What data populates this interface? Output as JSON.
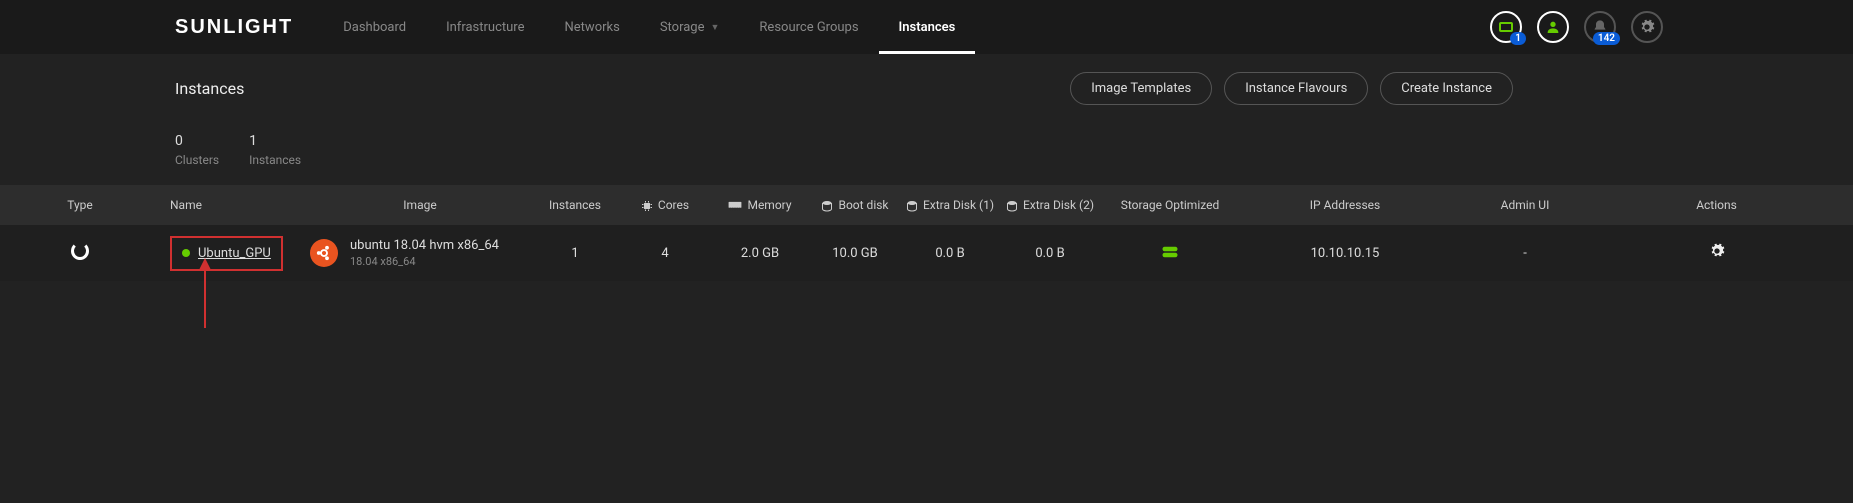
{
  "brand": "SUNLIGHT",
  "nav": {
    "items": [
      "Dashboard",
      "Infrastructure",
      "Networks",
      "Storage",
      "Resource Groups",
      "Instances"
    ],
    "active": "Instances"
  },
  "topicons": {
    "screen_badge": "1",
    "bell_badge": "142"
  },
  "page": {
    "title": "Instances",
    "actions": [
      "Image Templates",
      "Instance Flavours",
      "Create Instance"
    ]
  },
  "stats": [
    {
      "value": "0",
      "label": "Clusters"
    },
    {
      "value": "1",
      "label": "Instances"
    }
  ],
  "columns": {
    "type": "Type",
    "name": "Name",
    "image": "Image",
    "instances": "Instances",
    "cores": "Cores",
    "memory": "Memory",
    "boot": "Boot disk",
    "extra1": "Extra Disk (1)",
    "extra2": "Extra Disk (2)",
    "sopt": "Storage Optimized",
    "ip": "IP Addresses",
    "admin": "Admin UI",
    "actions": "Actions"
  },
  "row": {
    "name": "Ubuntu_GPU",
    "image_main": "ubuntu 18.04 hvm x86_64",
    "image_sub": "18.04 x86_64",
    "instances": "1",
    "cores": "4",
    "memory": "2.0 GB",
    "boot": "10.0 GB",
    "extra1": "0.0 B",
    "extra2": "0.0 B",
    "ip": "10.10.10.15",
    "admin": "-"
  }
}
